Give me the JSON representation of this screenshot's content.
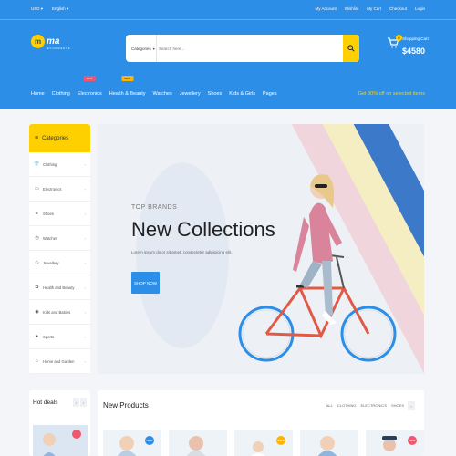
{
  "topbar": {
    "currency": "USD",
    "language": "English",
    "links": [
      "My Account",
      "Wishlist",
      "My Cart",
      "Checkout",
      "Login"
    ]
  },
  "logo": {
    "initial": "m",
    "text": "ma",
    "tagline": "ECOMMERCE"
  },
  "search": {
    "category": "Categories",
    "placeholder": "Search here..."
  },
  "cart": {
    "count": "0",
    "label": "Shopping Cart",
    "amount": "$4580"
  },
  "nav": {
    "items": [
      "Home",
      "Clothing",
      "Electronics",
      "Health & Beauty",
      "Watches",
      "Jewellery",
      "Shoes",
      "Kids & Girls",
      "Pages"
    ],
    "hot_tag": "HOT",
    "new_tag": "NEW",
    "promo": "Get 30% off on selected items"
  },
  "sidebar": {
    "title": "Categories",
    "items": [
      {
        "label": "Clothing",
        "icon": "shirt-icon"
      },
      {
        "label": "Electronics",
        "icon": "laptop-icon"
      },
      {
        "label": "Shoes",
        "icon": "shoe-icon"
      },
      {
        "label": "Watches",
        "icon": "watch-icon"
      },
      {
        "label": "Jewellery",
        "icon": "jewel-icon"
      },
      {
        "label": "Health and Beauty",
        "icon": "beauty-icon"
      },
      {
        "label": "Kids and Babies",
        "icon": "baby-icon"
      },
      {
        "label": "Sports",
        "icon": "ball-icon"
      },
      {
        "label": "Home and Garden",
        "icon": "home-icon"
      }
    ]
  },
  "hero": {
    "brand": "TOP BRANDS",
    "title": "New Collections",
    "subtitle": "Lorem ipsum dolor sit amet, consectetur adipisicing elit.",
    "button": "SHOP NOW"
  },
  "hotdeals": {
    "title": "Hot deals"
  },
  "newproducts": {
    "title": "New Products",
    "filters": [
      "ALL",
      "CLOTHING",
      "ELECTRONICS",
      "SHOES"
    ],
    "flags": [
      "NEW",
      "SALE",
      "NEW"
    ]
  },
  "colors": {
    "brand_blue": "#2d8ee8",
    "accent_yellow": "#ffd000",
    "hot_red": "#f2566f"
  }
}
